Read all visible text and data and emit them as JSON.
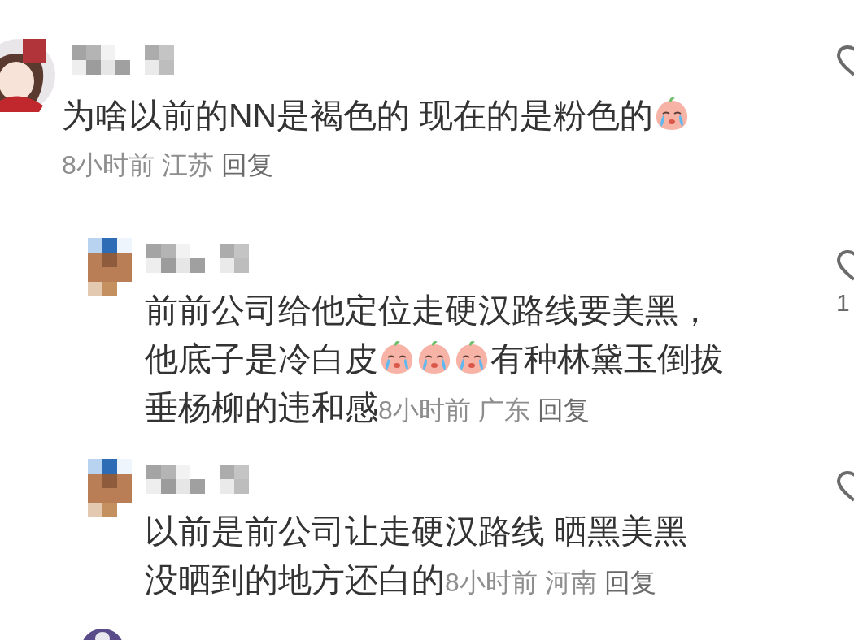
{
  "comments": [
    {
      "kind": "top",
      "avatar": {
        "kind": "round"
      },
      "lines": [
        [
          {
            "kind": "text",
            "text": "为啥以前的NN是褐色的 现在的是粉色的"
          },
          {
            "kind": "emoji"
          }
        ]
      ],
      "time": "8小时前",
      "location": "江苏",
      "reply": "回复"
    },
    {
      "kind": "reply",
      "avatar": {
        "kind": "square"
      },
      "lines": [
        [
          {
            "kind": "text",
            "text": "前前公司给他定位走硬汉路线要美黑，"
          }
        ],
        [
          {
            "kind": "text",
            "text": "他底子是冷白皮"
          },
          {
            "kind": "emoji"
          },
          {
            "kind": "emoji"
          },
          {
            "kind": "emoji"
          },
          {
            "kind": "text",
            "text": "有种林黛玉倒拔"
          }
        ],
        [
          {
            "kind": "text",
            "text": "垂杨柳的违和感"
          }
        ]
      ],
      "time": "8小时前",
      "location": "广东",
      "reply": "回复",
      "like_count": "1"
    },
    {
      "kind": "reply",
      "avatar": {
        "kind": "square"
      },
      "lines": [
        [
          {
            "kind": "text",
            "text": "以前是前公司让走硬汉路线  晒黑美黑"
          }
        ],
        [
          {
            "kind": "text",
            "text": "没晒到的地方还白的"
          }
        ]
      ],
      "time": "8小时前",
      "location": "河南",
      "reply": "回复"
    }
  ]
}
